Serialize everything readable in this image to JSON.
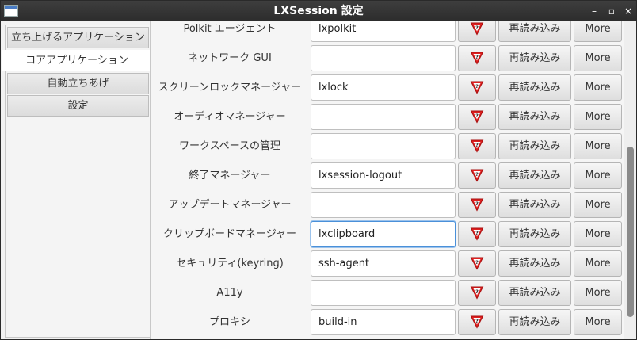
{
  "window": {
    "title": "LXSession 設定",
    "minimize_glyph": "–",
    "maximize_glyph": "▫",
    "close_glyph": "×"
  },
  "sidebar": {
    "tabs": [
      {
        "label": "立ち上げるアプリケーション"
      },
      {
        "label": "コアアプリケーション"
      },
      {
        "label": "自動立ちあげ"
      },
      {
        "label": "設定"
      }
    ],
    "active_tab": "コアアプリケーション"
  },
  "rows": [
    {
      "label": "Polkit エージェント",
      "value": "lxpolkit"
    },
    {
      "label": "ネットワーク GUI",
      "value": ""
    },
    {
      "label": "スクリーンロックマネージャー",
      "value": "lxlock"
    },
    {
      "label": "オーディオマネージャー",
      "value": ""
    },
    {
      "label": "ワークスペースの管理",
      "value": ""
    },
    {
      "label": "終了マネージャー",
      "value": "lxsession-logout"
    },
    {
      "label": "アップデートマネージャー",
      "value": ""
    },
    {
      "label": "クリップボードマネージャー",
      "value": "lxclipboard"
    },
    {
      "label": "セキュリティ(keyring)",
      "value": "ssh-agent"
    },
    {
      "label": "A11y",
      "value": ""
    },
    {
      "label": "プロキシ",
      "value": "build-in"
    }
  ],
  "buttons": {
    "reload_label": "再読み込み",
    "more_label": "More",
    "help_icon": "help-question-icon"
  },
  "focused_row": "クリップボードマネージャー",
  "colors": {
    "titlebar": "#333333",
    "focus_border": "#4a90d9",
    "help_icon_red": "#e02020"
  }
}
